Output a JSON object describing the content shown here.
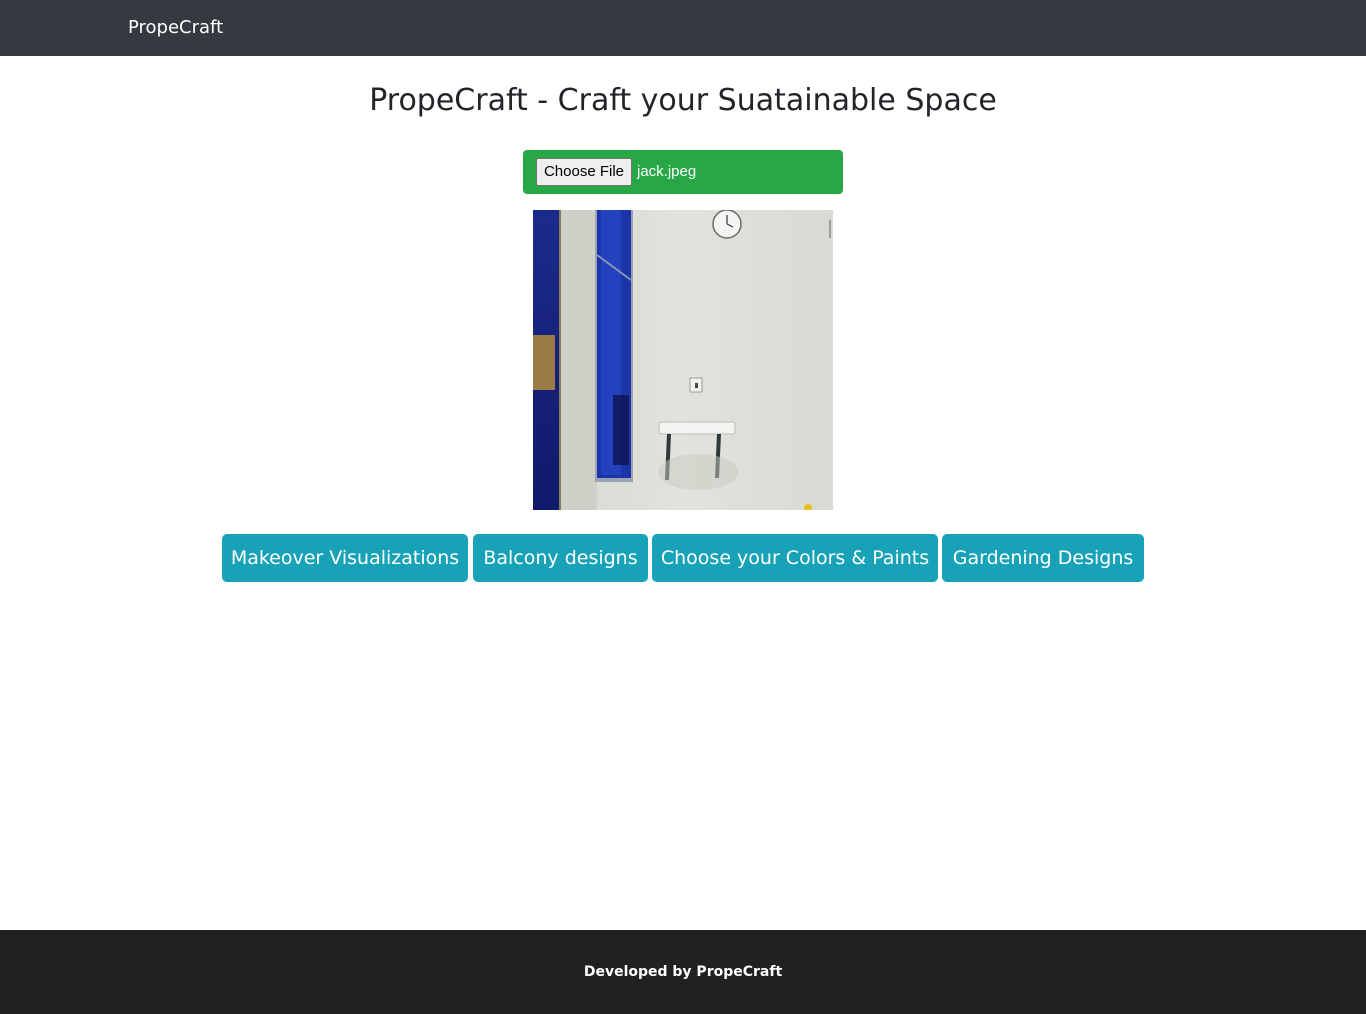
{
  "navbar": {
    "brand": "PropeCraft"
  },
  "main": {
    "title": "PropeCraft - Craft your Suatainable Space"
  },
  "upload": {
    "button_label": "Choose File",
    "file_name": "jack.jpeg"
  },
  "preview": {
    "alt": "Uploaded room photo"
  },
  "actions": [
    {
      "label": "Makeover Visualizations"
    },
    {
      "label": "Balcony designs"
    },
    {
      "label": "Choose your Colors & Paints"
    },
    {
      "label": "Gardening Designs"
    }
  ],
  "footer": {
    "text": "Developed by PropeCraft"
  },
  "colors": {
    "navbar": "#343a40",
    "upload": "#28a745",
    "button": "#17a2b8",
    "footer": "#212121"
  }
}
